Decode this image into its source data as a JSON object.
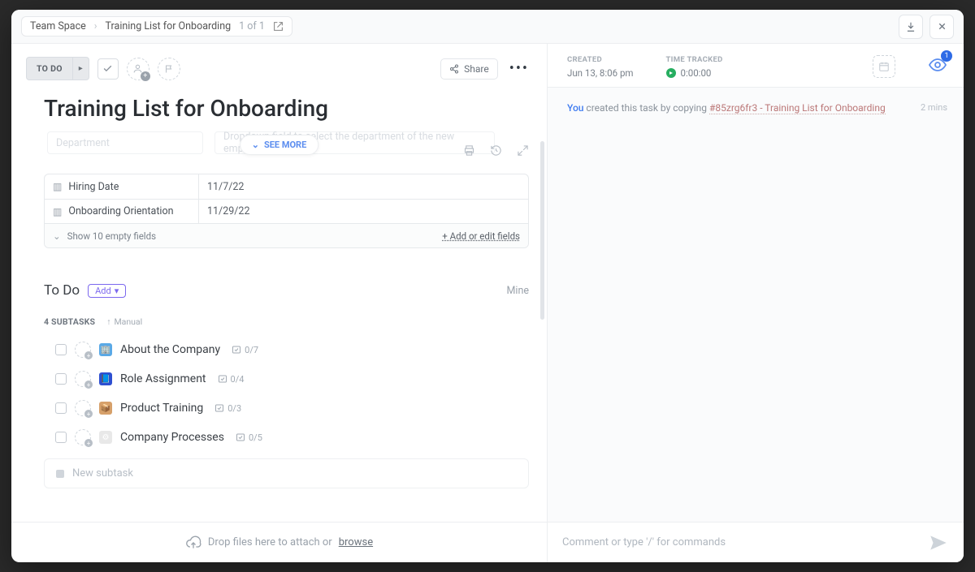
{
  "breadcrumb": {
    "space": "Team Space",
    "item": "Training List for Onboarding",
    "count": "1 of 1"
  },
  "toolbar": {
    "status": "TO DO",
    "share": "Share"
  },
  "task": {
    "title": "Training List for Onboarding",
    "see_more": "SEE MORE",
    "ghost_label1": "Department",
    "ghost_label2": "Dropdown field to select the department of the new employee"
  },
  "custom_fields": [
    {
      "label": "Hiring Date",
      "value": "11/7/22"
    },
    {
      "label": "Onboarding Orientation",
      "value": "11/29/22"
    }
  ],
  "cf_footer": {
    "show_empty": "Show 10 empty fields",
    "add_edit": "+ Add or edit fields"
  },
  "todo": {
    "heading": "To Do",
    "add": "Add",
    "mine": "Mine",
    "count_label": "4 SUBTASKS",
    "sort": "Manual"
  },
  "subtasks": [
    {
      "name": "About the Company",
      "progress": "0/7",
      "icon_bg": "#5aa9e6",
      "icon_glyph": "🏢"
    },
    {
      "name": "Role Assignment",
      "progress": "0/4",
      "icon_bg": "#2e4fd1",
      "icon_glyph": "📘"
    },
    {
      "name": "Product Training",
      "progress": "0/3",
      "icon_bg": "#d6a06a",
      "icon_glyph": "📦"
    },
    {
      "name": "Company Processes",
      "progress": "0/5",
      "icon_bg": "#e8e8e8",
      "icon_glyph": "⚙"
    }
  ],
  "new_subtask_placeholder": "New subtask",
  "dropzone": {
    "text": "Drop files here to attach or",
    "browse": "browse"
  },
  "meta": {
    "created_label": "CREATED",
    "created_value": "Jun 13, 8:06 pm",
    "time_label": "TIME TRACKED",
    "time_value": "0:00:00",
    "watchers": "1"
  },
  "activity": {
    "you": "You",
    "text": "created this task by copying",
    "link": "#85zrg6fr3 - Training List for Onboarding",
    "when": "2 mins"
  },
  "comment_placeholder": "Comment or type '/' for commands"
}
